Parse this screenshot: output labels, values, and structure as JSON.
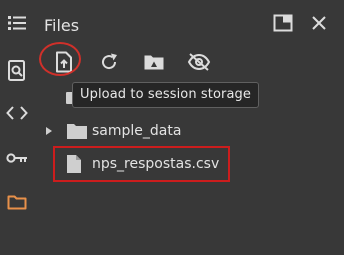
{
  "panel": {
    "title": "Files"
  },
  "toolbar": {
    "upload": {
      "icon": "upload-file-icon",
      "tooltip": "Upload to session storage"
    },
    "refresh": {
      "icon": "refresh-icon"
    },
    "mount_drive": {
      "icon": "drive-folder-icon"
    },
    "toggle_hidden": {
      "icon": "eye-off-icon"
    }
  },
  "header_actions": [
    "open-in-tab-icon",
    "close-icon"
  ],
  "rail": [
    "menu-list-icon",
    "find-icon",
    "code-icon",
    "key-icon",
    "folder-icon"
  ],
  "files": [
    {
      "type": "folder",
      "name": "sample_data",
      "icon": "folder-icon"
    },
    {
      "type": "file",
      "name": "nps_respostas.csv",
      "icon": "file-icon"
    }
  ],
  "colors": {
    "background": "#383838",
    "icon": "#dcdcdc",
    "active_rail": "#e8914a",
    "annotation_red": "#cc1d1d"
  }
}
